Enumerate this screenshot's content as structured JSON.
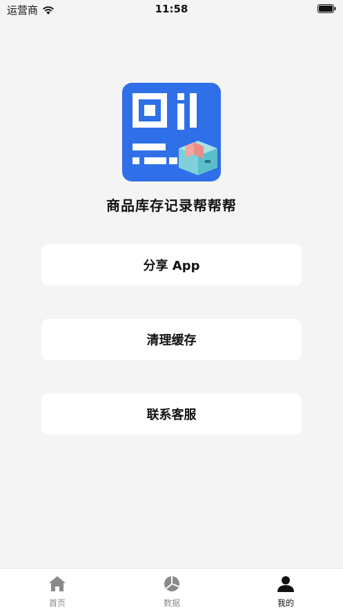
{
  "status_bar": {
    "carrier": "运营商",
    "time": "11:58"
  },
  "app": {
    "name": "商品库存记录帮帮帮",
    "icon_accent": "#2f6fe8"
  },
  "menu": {
    "share_label": "分享 App",
    "clear_cache_label": "清理缓存",
    "contact_label": "联系客服"
  },
  "tab_bar": {
    "home_label": "首页",
    "data_label": "数据",
    "mine_label": "我的",
    "active_tab": "我的",
    "active_color": "#111111",
    "inactive_color": "#8a8a8a"
  }
}
